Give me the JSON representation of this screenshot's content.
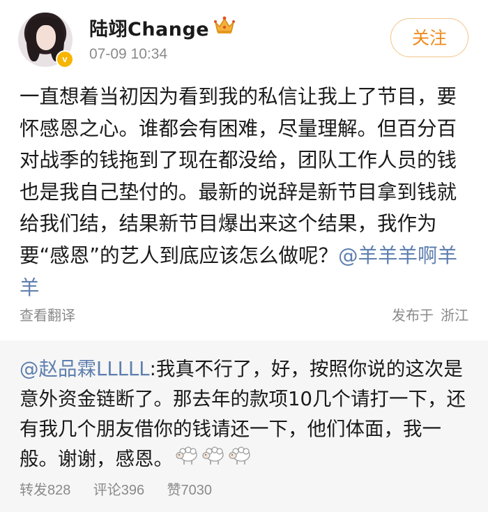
{
  "post": {
    "author": "陆翊Change",
    "timestamp": "07-09 10:34",
    "follow_label": "关注",
    "text": "一直想着当初因为看到我的私信让我上了节目，要怀感恩之心。谁都会有困难，尽量理解。但百分百对战季的钱拖到了现在都没给，团队工作人员的钱也是我自己垫付的。最新的说辞是新节目拿到钱就给我们结，结果新节目爆出来这个结果，我作为要“感恩”的艺人到底应该怎么做呢？",
    "mention": "@羊羊羊啊羊羊",
    "translate_label": "查看翻译",
    "location_prefix": "发布于",
    "location": "浙江"
  },
  "repost": {
    "mention": "@赵品霖LLLLL",
    "text": ":我真不行了，好，按照你说的这次是意外资金链断了。那去年的款项10几个请打一下，还有我几个朋友借你的钱请还一下，他们体面，我一般。谢谢，感恩。",
    "stats": {
      "repost_label": "转发",
      "repost_count": "828",
      "comment_label": "评论",
      "comment_count": "396",
      "like_label": "赞",
      "like_count": "7030"
    }
  },
  "colors": {
    "mention": "#5e7faf",
    "follow": "#ef8a1c",
    "follow_border": "#f2c48a",
    "meta": "#8a8a8a",
    "repost_bg": "#f6f6f6"
  },
  "icons": {
    "avatar": "user-avatar",
    "verified": "gold-verified-badge",
    "crown": "crown-membership-icon",
    "sheep": "sheep-emoji"
  }
}
